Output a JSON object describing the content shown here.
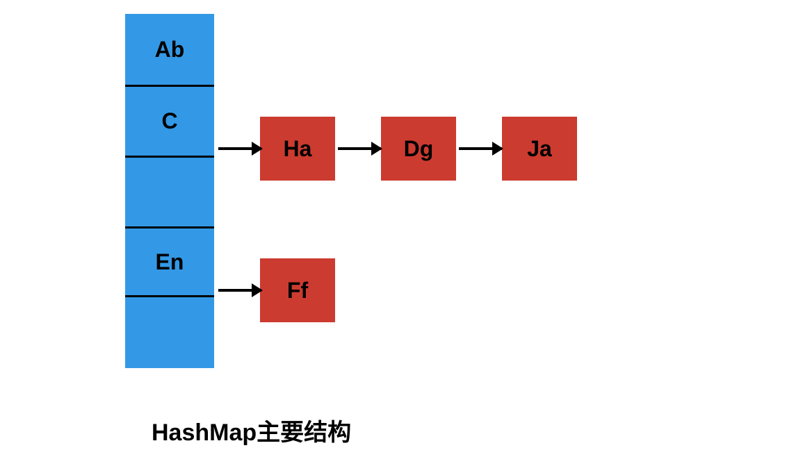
{
  "caption": "HashMap主要结构",
  "buckets": {
    "b0": "Ab",
    "b1": "C",
    "b2": "",
    "b3": "En",
    "b4": ""
  },
  "chain1": {
    "n0": "Ha",
    "n1": "Dg",
    "n2": "Ja"
  },
  "chain3": {
    "n0": "Ff"
  }
}
